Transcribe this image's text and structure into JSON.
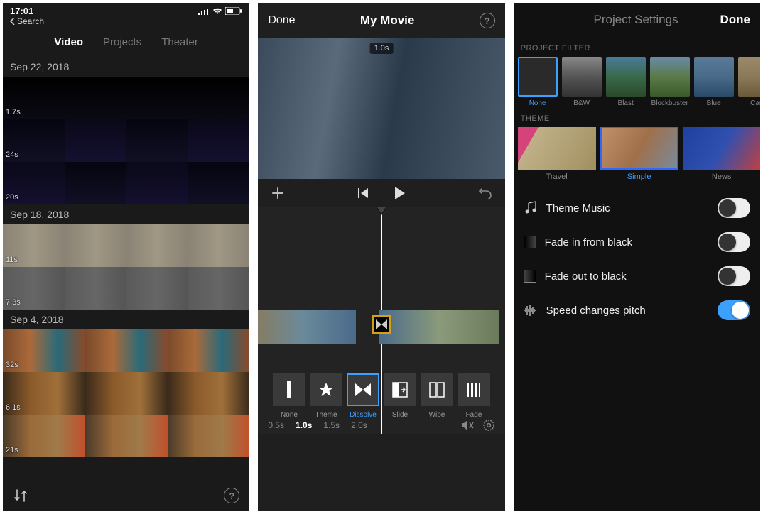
{
  "screen1": {
    "status_time": "17:01",
    "back_label": "Search",
    "tabs": [
      "Video",
      "Projects",
      "Theater"
    ],
    "active_tab": "Video",
    "sections": [
      {
        "date": "Sep 22, 2018",
        "clips": [
          {
            "dur": "1.7s"
          },
          {
            "dur": "24s"
          },
          {
            "dur": "20s"
          }
        ]
      },
      {
        "date": "Sep 18, 2018",
        "clips": [
          {
            "dur": "11s"
          },
          {
            "dur": "7.3s"
          }
        ]
      },
      {
        "date": "Sep 4, 2018",
        "clips": [
          {
            "dur": "32s"
          },
          {
            "dur": "6.1s"
          },
          {
            "dur": "21s"
          }
        ]
      }
    ]
  },
  "screen2": {
    "done_label": "Done",
    "title": "My Movie",
    "preview_time": "1.0s",
    "transitions": [
      {
        "name": "None"
      },
      {
        "name": "Theme"
      },
      {
        "name": "Dissolve"
      },
      {
        "name": "Slide"
      },
      {
        "name": "Wipe"
      },
      {
        "name": "Fade"
      }
    ],
    "selected_transition": "Dissolve",
    "durations": [
      "0.5s",
      "1.0s",
      "1.5s",
      "2.0s"
    ],
    "selected_duration": "1.0s"
  },
  "screen3": {
    "title": "Project Settings",
    "done_label": "Done",
    "filter_section": "PROJECT FILTER",
    "filters": [
      "None",
      "B&W",
      "Blast",
      "Blockbuster",
      "Blue",
      "Cam"
    ],
    "selected_filter": "None",
    "theme_section": "THEME",
    "themes": [
      "Travel",
      "Simple",
      "News"
    ],
    "selected_theme": "Simple",
    "toggles": [
      {
        "icon": "music",
        "label": "Theme Music",
        "on": false
      },
      {
        "icon": "fadein",
        "label": "Fade in from black",
        "on": false
      },
      {
        "icon": "fadeout",
        "label": "Fade out to black",
        "on": false
      },
      {
        "icon": "pitch",
        "label": "Speed changes pitch",
        "on": true
      }
    ]
  }
}
